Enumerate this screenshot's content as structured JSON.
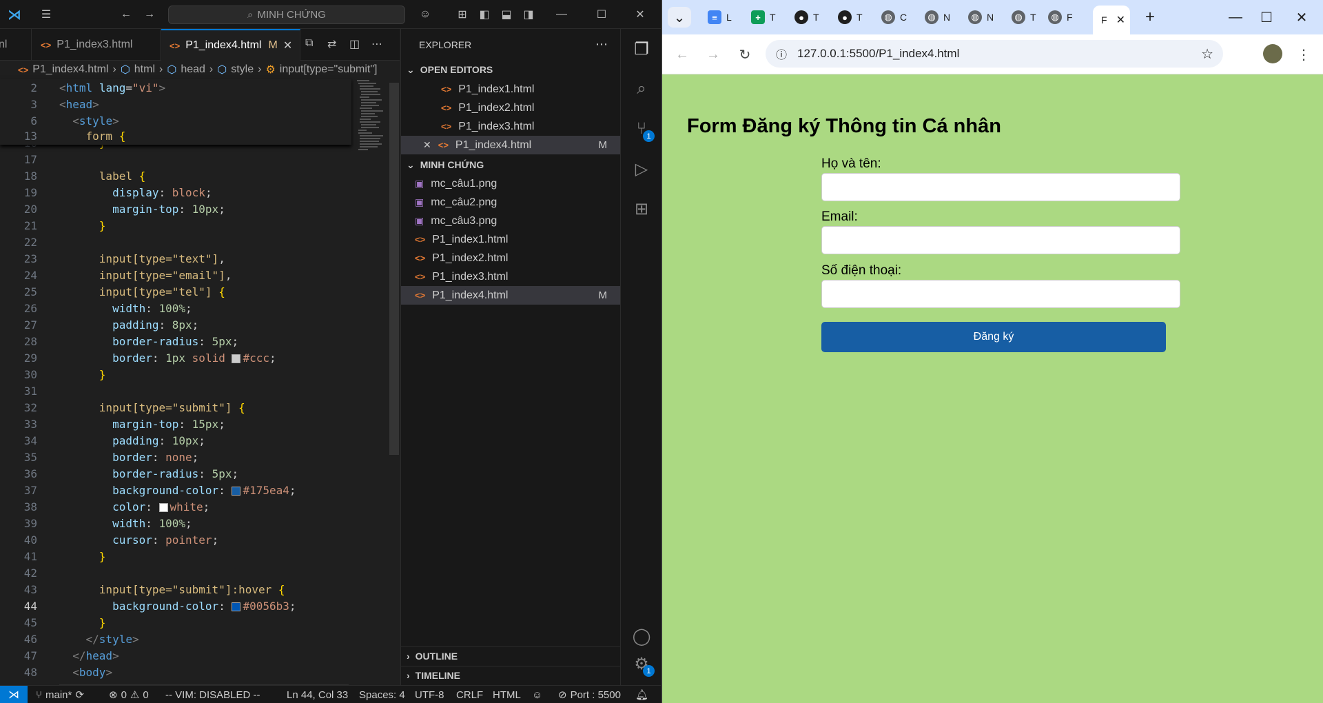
{
  "vscode": {
    "search_text": "MINH CHỨNG",
    "tabs": [
      {
        "label": "nl"
      },
      {
        "label": "P1_index3.html"
      },
      {
        "label": "P1_index4.html",
        "modified": "M"
      }
    ],
    "breadcrumb": [
      "P1_index4.html",
      "html",
      "head",
      "style",
      "input[type=\"submit\"]"
    ],
    "explorer": {
      "title": "EXPLORER",
      "open_editors_label": "OPEN EDITORS",
      "open_editors": [
        "P1_index1.html",
        "P1_index2.html",
        "P1_index3.html",
        "P1_index4.html"
      ],
      "open_editor_badge": "M",
      "folder_label": "MINH CHỨNG",
      "files": [
        "mc_câu1.png",
        "mc_câu2.png",
        "mc_câu3.png",
        "P1_index1.html",
        "P1_index2.html",
        "P1_index3.html",
        "P1_index4.html"
      ],
      "file_badge": "M",
      "outline_label": "OUTLINE",
      "timeline_label": "TIMELINE"
    },
    "line_numbers": [
      "16",
      "17",
      "18",
      "19",
      "20",
      "21",
      "22",
      "23",
      "24",
      "25",
      "26",
      "27",
      "28",
      "29",
      "30",
      "31",
      "32",
      "33",
      "34",
      "35",
      "36",
      "37",
      "38",
      "39",
      "40",
      "41",
      "42",
      "43",
      "44",
      "45",
      "46",
      "47",
      "48"
    ],
    "sticky_line_numbers": [
      "2",
      "3",
      "6",
      "13"
    ],
    "activity_badges": {
      "scm": "1",
      "settings": "1"
    },
    "status": {
      "branch": "main*",
      "problems": "0",
      "warnings": "0",
      "vim": "-- VIM: DISABLED --",
      "cursor": "Ln 44, Col 33",
      "spaces": "Spaces: 4",
      "encoding": "UTF-8",
      "eol": "CRLF",
      "language": "HTML",
      "port": "Port : 5500"
    },
    "colors": {
      "accent": "#0078d4",
      "swatch_ccc": "#cccccc",
      "swatch_blue": "#175ea4",
      "swatch_white": "#ffffff",
      "swatch_hover": "#0056b3"
    }
  },
  "browser": {
    "tabs": [
      {
        "letter": "L",
        "icon": "docs-icon",
        "color": "#4285f4"
      },
      {
        "letter": "T",
        "icon": "sheets-icon",
        "color": "#0f9d58"
      },
      {
        "letter": "T",
        "icon": "github-icon",
        "color": "#1f1f1f"
      },
      {
        "letter": "T",
        "icon": "github-icon",
        "color": "#1f1f1f"
      },
      {
        "letter": "C",
        "icon": "globe-icon",
        "color": "#5f6368"
      },
      {
        "letter": "N",
        "icon": "globe-icon",
        "color": "#5f6368"
      },
      {
        "letter": "N",
        "icon": "globe-icon",
        "color": "#5f6368"
      },
      {
        "letter": "T",
        "icon": "globe-icon",
        "color": "#5f6368"
      },
      {
        "letter": "F",
        "icon": "globe-icon",
        "color": "#5f6368"
      }
    ],
    "active_tab_letter": "F",
    "url": "127.0.0.1:5500/P1_index4.html",
    "page": {
      "title": "Form Đăng ký Thông tin Cá nhân",
      "name_label": "Họ và tên:",
      "email_label": "Email:",
      "phone_label": "Số điện thoại:",
      "submit_label": "Đăng ký",
      "background": "#abd982",
      "button_color": "#175ea4"
    }
  }
}
